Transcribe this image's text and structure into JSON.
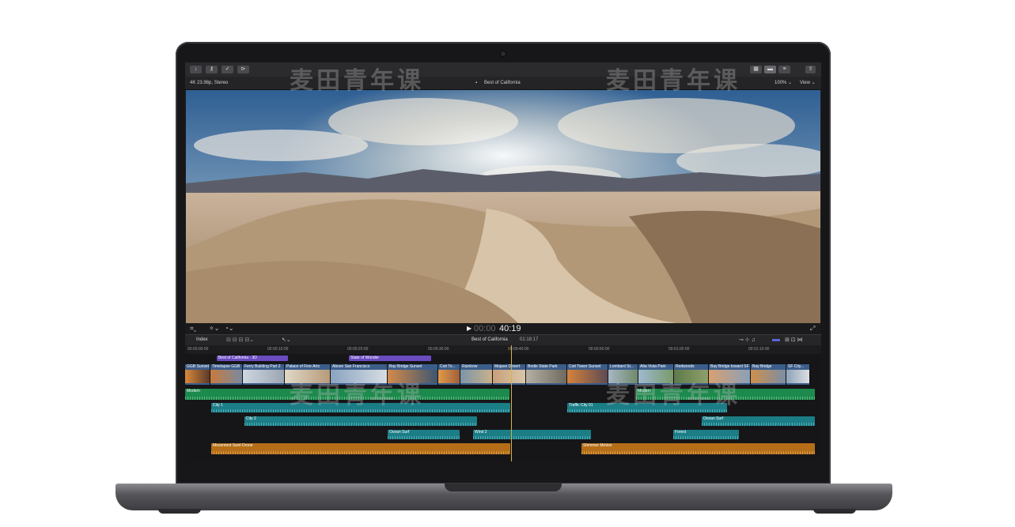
{
  "toolbar": {
    "buttons": [
      "import",
      "keywords",
      "check",
      "tag"
    ],
    "right_buttons": [
      "grid",
      "film",
      "inspector",
      "share"
    ]
  },
  "infobar": {
    "format": "4K 23.98p, Stereo",
    "project_title": "Best of California",
    "zoom": "100%",
    "view_menu": "View"
  },
  "transport": {
    "timecode_dim": "00:00",
    "timecode": "40:19"
  },
  "timeline_header": {
    "index_label": "Index",
    "project_name": "Best of California",
    "duration": "01:18:17"
  },
  "ruler_ticks": [
    "00:00:00:00",
    "00:00:10:00",
    "00:00:20:00",
    "00:00:30:00",
    "00:00:40:00",
    "00:00:50:00",
    "00:01:00:00",
    "00:01:10:00"
  ],
  "titles": [
    {
      "label": "Best of California - 3D"
    },
    {
      "label": "State of Wonder"
    }
  ],
  "video_clips": [
    "GGB Sunset",
    "Timelapse GGB",
    "Ferry Building Part 2",
    "Palace of Fine Arts",
    "Above San Francisco",
    "Bay Bridge Sunset",
    "Coit To...",
    "Rainbow",
    "Mojave Desert",
    "Bodie State Park",
    "Coit Tower Sunset",
    "Lombard St...",
    "Alta Vista Park",
    "Redwoods",
    "Bay Bridge toward SF",
    "Bay Bridge",
    "SF City..."
  ],
  "music_clips": [
    "Modern",
    "Modern"
  ],
  "audio_clips": [
    "City 1",
    "Traffic City 01",
    "City 2",
    "Ocean Surf",
    "Ocean Surf",
    "Wind 2",
    "Forest",
    "Movement Swirl Drone",
    "Shimmer Motion"
  ],
  "watermark": "麦田青年课",
  "colors": {
    "accent_purple": "#6a4bc0",
    "audio_teal": "#1b7d86",
    "music_green": "#1c8a4c",
    "sfx_orange": "#b56e17",
    "playhead": "#d4b24a"
  }
}
